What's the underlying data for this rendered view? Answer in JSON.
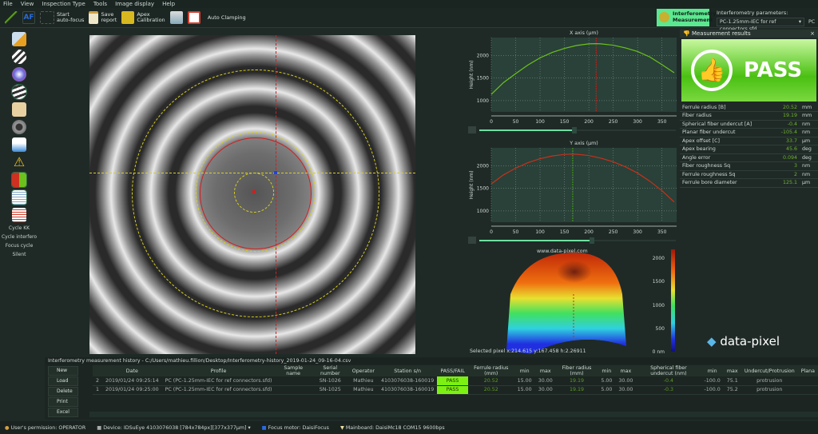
{
  "menu": [
    "File",
    "View",
    "Inspection Type",
    "Tools",
    "Image display",
    "Help"
  ],
  "toolbar": {
    "autofocus": "Start\nauto-focus",
    "save": "Save\nreport",
    "apex": "Apex\nCalibration",
    "clamping": "Auto Clamping",
    "mode": "Interferometry\nMeasurement",
    "params_label": "Interferometry parameters:",
    "params_value": "PC-1.25mm-IEC for ref connectors.sfd",
    "params_suffix": "PC"
  },
  "sidebar": {
    "labels": [
      "Cycle KK",
      "Cycle interfero",
      "Focus cycle",
      "Silent"
    ]
  },
  "chart_data": [
    {
      "type": "line",
      "title": "X axis (µm)",
      "ylabel": "Height (nm)",
      "xlim": [
        0,
        380
      ],
      "ylim": [
        750,
        2400
      ],
      "xticks": [
        0,
        50,
        100,
        150,
        200,
        250,
        300,
        350
      ],
      "yticks": [
        1000,
        1500,
        2000
      ],
      "grid": true,
      "color": "#6cc21a",
      "cursor": {
        "x": 215,
        "color": "#c0221a"
      },
      "x": [
        0,
        25,
        50,
        75,
        100,
        125,
        150,
        175,
        200,
        215,
        225,
        250,
        275,
        300,
        325,
        350,
        375
      ],
      "y": [
        1140,
        1400,
        1600,
        1790,
        1950,
        2070,
        2160,
        2225,
        2260,
        2265,
        2260,
        2230,
        2170,
        2090,
        1970,
        1800,
        1620
      ]
    },
    {
      "type": "line",
      "title": "Y axis (µm)",
      "ylabel": "Height (nm)",
      "xlim": [
        0,
        380
      ],
      "ylim": [
        750,
        2400
      ],
      "xticks": [
        0,
        50,
        100,
        150,
        200,
        250,
        300,
        350
      ],
      "yticks": [
        1000,
        1500,
        2000
      ],
      "grid": true,
      "color": "#c8301a",
      "cursor": {
        "x": 167,
        "color": "#4aa01a"
      },
      "x": [
        0,
        25,
        50,
        75,
        100,
        125,
        150,
        167,
        175,
        200,
        225,
        250,
        275,
        300,
        325,
        350,
        375
      ],
      "y": [
        1600,
        1800,
        1950,
        2070,
        2160,
        2220,
        2255,
        2262,
        2258,
        2230,
        2170,
        2090,
        1980,
        1840,
        1660,
        1450,
        1200
      ]
    }
  ],
  "surface": {
    "watermark": "www.data-pixel.com",
    "selected": "Selected pixel x:214.615 y:167.458 h:2.26911",
    "scale_ticks": [
      "2000",
      "1500",
      "1000",
      "500",
      "0 nm"
    ]
  },
  "results": {
    "title": "Measurement results",
    "verdict": "PASS",
    "rows": [
      {
        "label": "Ferrule radius [B]",
        "value": "20.52",
        "unit": "mm"
      },
      {
        "label": "Fiber radius",
        "value": "19.19",
        "unit": "mm"
      },
      {
        "label": "Spherical fiber undercut [A]",
        "value": "-0.4",
        "unit": "nm"
      },
      {
        "label": "Planar fiber undercut",
        "value": "-105.4",
        "unit": "nm"
      },
      {
        "label": "Apex offset [C]",
        "value": "33.7",
        "unit": "µm"
      },
      {
        "label": "Apex bearing",
        "value": "45.6",
        "unit": "deg"
      },
      {
        "label": "Angle error",
        "value": "0.094",
        "unit": "deg"
      },
      {
        "label": "Fiber roughness Sq",
        "value": "3",
        "unit": "nm"
      },
      {
        "label": "Ferrule roughness Sq",
        "value": "2",
        "unit": "nm"
      },
      {
        "label": "Ferrule bore diameter",
        "value": "125.1",
        "unit": "µm"
      }
    ]
  },
  "logo": "data-pixel",
  "history": {
    "title": "Interferometry measurement history - C:/Users/mathieu.fillion/Desktop/Interferometry-history_2019-01-24_09-16-04.csv",
    "buttons": [
      "New",
      "Load",
      "Delete",
      "Print",
      "Excel"
    ],
    "columns": [
      "",
      "Date",
      "Profile",
      "Sample name",
      "Serial number",
      "Operator",
      "Station s/n",
      "PASS/FAIL",
      "Ferrule radius (mm)",
      "min",
      "max",
      "Fiber radius (mm)",
      "min",
      "max",
      "Spherical fiber undercut (nm)",
      "min",
      "max",
      "Undercut/Protrusion",
      "Plana"
    ],
    "rows": [
      [
        "2",
        "2019/01/24 09:25:14",
        "PC (PC-1.25mm-IEC for ref connectors.sfd)",
        "",
        "SN-1026",
        "Mathieu",
        "4103076038-160019",
        "PASS",
        "20.52",
        "15.00",
        "30.00",
        "19.19",
        "5.00",
        "30.00",
        "-0.4",
        "-100.0",
        "75.1",
        "protrusion",
        ""
      ],
      [
        "1",
        "2019/01/24 09:25:00",
        "PC (PC-1.25mm-IEC for ref connectors.sfd)",
        "",
        "SN-1025",
        "Mathieu",
        "4103076038-160019",
        "PASS",
        "20.52",
        "15.00",
        "30.00",
        "19.19",
        "5.00",
        "30.00",
        "-0.3",
        "-100.0",
        "75.2",
        "protrusion",
        ""
      ]
    ]
  },
  "status": {
    "permission": "User's permission: OPERATOR",
    "device": "Device: IDSuEye 4103076038 [784x784px][377x377µm]",
    "focus": "Focus motor: DaisiFocus",
    "mainboard": "Mainboard: DaisiMc18 COM15 9600bps"
  }
}
